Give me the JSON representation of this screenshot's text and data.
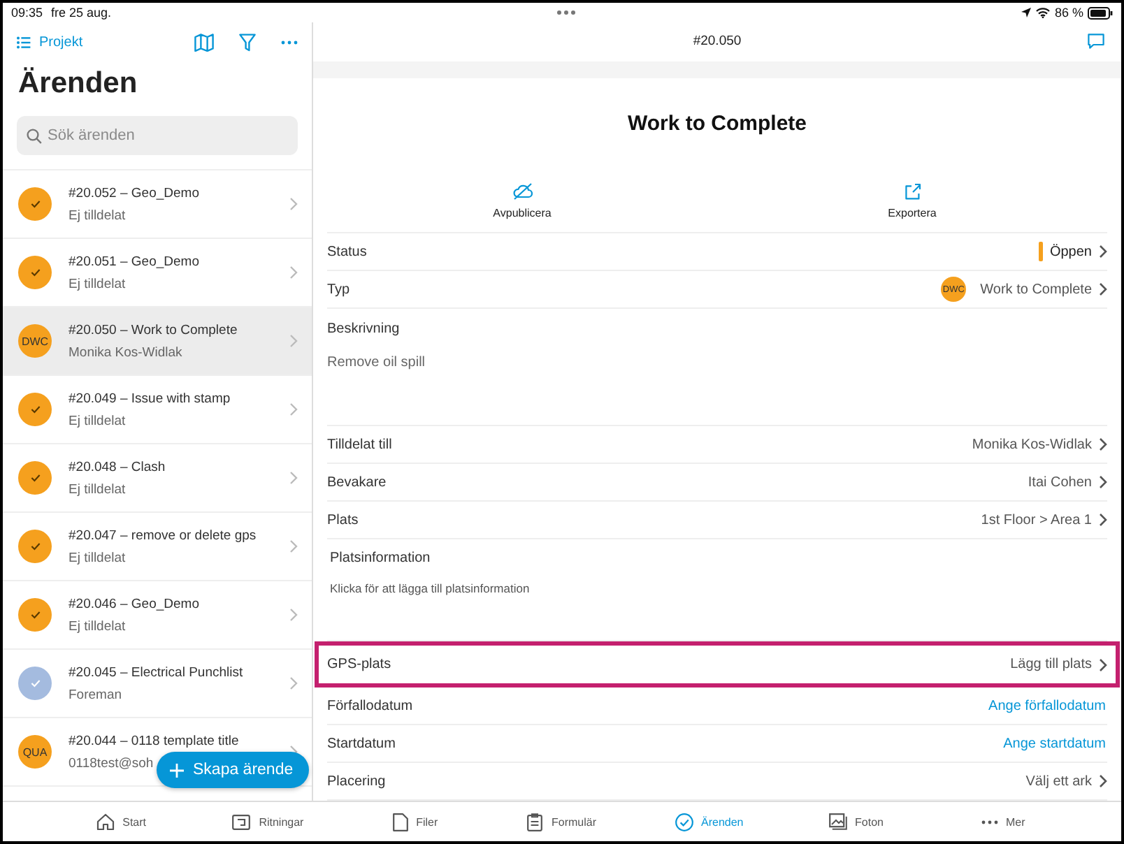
{
  "status_bar": {
    "time": "09:35",
    "date": "fre 25 aug.",
    "battery": "86 %"
  },
  "sidebar": {
    "project_link": "Projekt",
    "title": "Ärenden",
    "search": {
      "placeholder": "Sök ärenden"
    },
    "issues": [
      {
        "title": "#20.052 – Geo_Demo",
        "subtitle": "Ej tilldelat",
        "avatar": {
          "kind": "check",
          "color": "#f5a01e"
        },
        "selected": false
      },
      {
        "title": "#20.051 – Geo_Demo",
        "subtitle": "Ej tilldelat",
        "avatar": {
          "kind": "check",
          "color": "#f5a01e"
        },
        "selected": false
      },
      {
        "title": "#20.050 – Work to Complete",
        "subtitle": "Monika Kos-Widlak",
        "avatar": {
          "kind": "initials",
          "text": "DWC",
          "color": "#f5a01e"
        },
        "selected": true
      },
      {
        "title": "#20.049 – Issue with stamp",
        "subtitle": "Ej tilldelat",
        "avatar": {
          "kind": "check",
          "color": "#f5a01e"
        },
        "selected": false
      },
      {
        "title": "#20.048 – Clash",
        "subtitle": "Ej tilldelat",
        "avatar": {
          "kind": "check",
          "color": "#f5a01e"
        },
        "selected": false
      },
      {
        "title": "#20.047 – remove or delete gps",
        "subtitle": "Ej tilldelat",
        "avatar": {
          "kind": "check",
          "color": "#f5a01e"
        },
        "selected": false
      },
      {
        "title": "#20.046 – Geo_Demo",
        "subtitle": "Ej tilldelat",
        "avatar": {
          "kind": "check",
          "color": "#f5a01e"
        },
        "selected": false
      },
      {
        "title": "#20.045 – Electrical Punchlist",
        "subtitle": "Foreman",
        "avatar": {
          "kind": "check",
          "color": "#a4bbdf"
        },
        "selected": false
      },
      {
        "title": "#20.044 – 0118 template title",
        "subtitle": "0118test@soh",
        "avatar": {
          "kind": "initials",
          "text": "QUA",
          "color": "#f5a01e"
        },
        "selected": false
      }
    ],
    "create_button": "Skapa ärende"
  },
  "detail": {
    "header": "#20.050",
    "title": "Work to Complete",
    "actions": [
      {
        "kind": "unpublish",
        "label": "Avpublicera"
      },
      {
        "kind": "export",
        "label": "Exportera"
      }
    ],
    "fields": [
      {
        "kind": "status",
        "label": "Status",
        "value": "Öppen",
        "color": "#f5a01e",
        "highlighted": false
      },
      {
        "kind": "type",
        "label": "Typ",
        "badge": "DWC",
        "value": "Work to Complete",
        "highlighted": false
      },
      {
        "kind": "text",
        "label": "Beskrivning",
        "value": "Remove oil spill",
        "highlighted": false
      },
      {
        "kind": "nav",
        "label": "Tilldelat till",
        "value": "Monika Kos-Widlak",
        "highlighted": false
      },
      {
        "kind": "nav",
        "label": "Bevakare",
        "value": "Itai Cohen",
        "highlighted": false
      },
      {
        "kind": "nav",
        "label": "Plats",
        "value": "1st Floor > Area 1",
        "highlighted": false
      },
      {
        "kind": "hint",
        "label": "Platsinformation",
        "value": "Klicka för att lägga till platsinformation",
        "highlighted": false
      },
      {
        "kind": "nav",
        "label": "GPS-plats",
        "value": "Lägg till plats",
        "highlighted": true
      },
      {
        "kind": "link",
        "label": "Förfallodatum",
        "value": "Ange förfallodatum",
        "highlighted": false
      },
      {
        "kind": "link",
        "label": "Startdatum",
        "value": "Ange startdatum",
        "highlighted": false
      },
      {
        "kind": "nav",
        "label": "Placering",
        "value": "Välj ett ark",
        "highlighted": false
      }
    ]
  },
  "tabs": [
    {
      "label": "Start",
      "selected": false
    },
    {
      "label": "Ritningar",
      "selected": false
    },
    {
      "label": "Filer",
      "selected": false
    },
    {
      "label": "Formulär",
      "selected": false
    },
    {
      "label": "Ärenden",
      "selected": true
    },
    {
      "label": "Foton",
      "selected": false
    },
    {
      "label": "Mer",
      "selected": false
    }
  ]
}
